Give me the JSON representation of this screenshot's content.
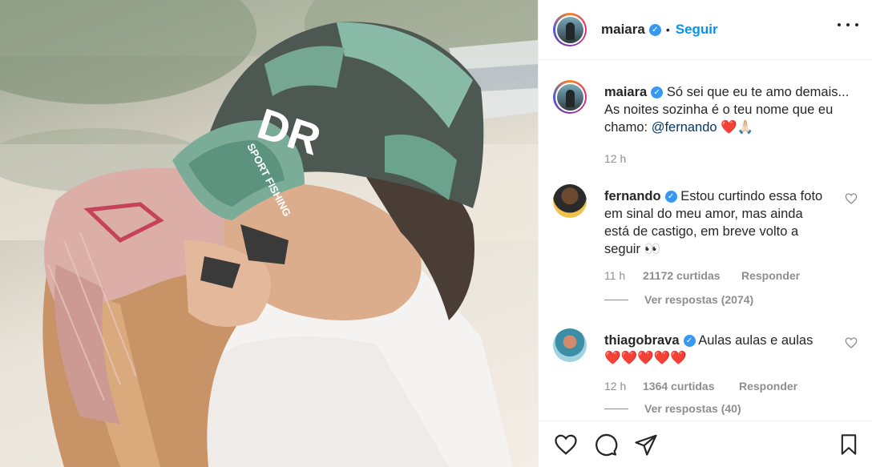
{
  "post": {
    "author": "maiara",
    "follow_label": "Seguir",
    "dot": "•",
    "verified_mark": "✓",
    "more_icon": "ellipsis-icon"
  },
  "caption": {
    "username": "maiara",
    "text": "Só sei que eu te amo demais... As noites sozinha é o teu nome que eu chamo:",
    "mention": "@fernando",
    "emoji": "❤️🙏🏻",
    "time": "12 h"
  },
  "comments": [
    {
      "username": "fernando",
      "text": "Estou curtindo essa foto em sinal do meu amor, mas ainda está de castigo, em breve volto a seguir 👀",
      "time": "11 h",
      "likes": "21172 curtidas",
      "reply_label": "Responder",
      "view_replies": "Ver respostas (2074)"
    },
    {
      "username": "thiagobrava",
      "text": "Aulas aulas e aulas",
      "emoji": "❤️❤️❤️❤️❤️",
      "time": "12 h",
      "likes": "1364 curtidas",
      "reply_label": "Responder",
      "view_replies": "Ver respostas (40)"
    }
  ],
  "actions": {
    "icons": [
      "heart-icon",
      "comment-icon",
      "share-icon",
      "bookmark-icon"
    ]
  },
  "photo": {
    "cap_text": "DR",
    "cap_subtext": "SPORT FISHING"
  },
  "colors": {
    "link": "#0095f6",
    "mention": "#00376b",
    "muted": "#8e8e8e",
    "verified": "#3897f0"
  }
}
